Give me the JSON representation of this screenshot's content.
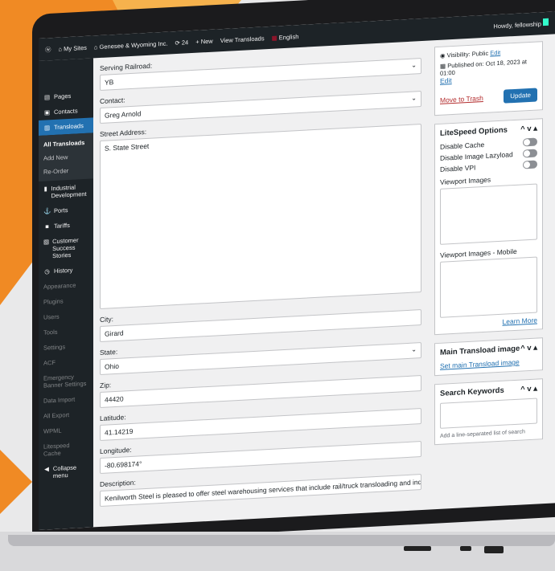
{
  "colors": {
    "accent": "#2271b1",
    "adminbar": "#1d2327",
    "trash": "#b32d2e",
    "brand_orange": "#f08a24"
  },
  "adminbar": {
    "my_sites": "My Sites",
    "site": "Genesee & Wyoming Inc.",
    "updates": "24",
    "new": "New",
    "view": "View Transloads",
    "lang": "English",
    "howdy": "Howdy, fellowship"
  },
  "sidebar": {
    "pages": "Pages",
    "contacts": "Contacts",
    "transloads": "Transloads",
    "sub": [
      "All Transloads",
      "Add New",
      "Re-Order"
    ],
    "industrial": "Industrial Development",
    "ports": "Ports",
    "tariffs": "Tariffs",
    "customer": "Customer Success Stories",
    "history": "History",
    "dim": [
      "Appearance",
      "Plugins",
      "Users",
      "Tools",
      "Settings",
      "ACF",
      "Emergency Banner Settings",
      "Data Import",
      "All Export",
      "WPML",
      "Litespeed Cache"
    ],
    "collapse": "Collapse menu"
  },
  "form": {
    "serving_label": "Serving Railroad:",
    "serving_value": "YB",
    "contact_label": "Contact:",
    "contact_value": "Greg Arnold",
    "street_label": "Street Address:",
    "street_value": "S. State Street",
    "city_label": "City:",
    "city_value": "Girard",
    "state_label": "State:",
    "state_value": "Ohio",
    "zip_label": "Zip:",
    "zip_value": "44420",
    "lat_label": "Latitude:",
    "lat_value": "41.14219",
    "lng_label": "Longitude:",
    "lng_value": "-80.698174°",
    "desc_label": "Description:",
    "desc_value": "Kenilworth Steel is pleased to offer steel warehousing services that include rail/truck transloading and indoor under hook"
  },
  "publish": {
    "visibility": "Visibility: Public",
    "edit": "Edit",
    "published": "Published on: Oct 18, 2023 at 01:00",
    "edit2": "Edit",
    "trash": "Move to Trash",
    "update": "Update"
  },
  "litespeed": {
    "title": "LiteSpeed Options",
    "cache": "Disable Cache",
    "lazy": "Disable Image Lazyload",
    "vpi": "Disable VPI",
    "vp_images": "Viewport Images",
    "vp_mobile": "Viewport Images - Mobile",
    "learn": "Learn More"
  },
  "image_box": {
    "title": "Main Transload image",
    "link": "Set main Transload image"
  },
  "keywords": {
    "title": "Search Keywords",
    "hint": "Add a line-separated list of search"
  }
}
